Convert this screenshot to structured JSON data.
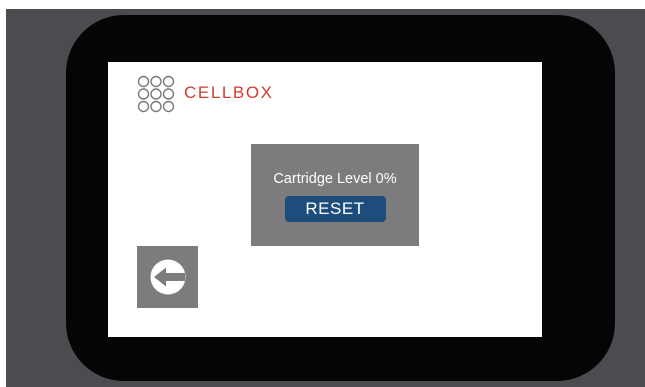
{
  "app": {
    "brand_name": "CELLBOX",
    "brand_color": "#d23b33"
  },
  "cartridge": {
    "label": "Cartridge Level 0%",
    "level_percent": 0,
    "reset_label": "RESET",
    "reset_color": "#1d4d7a",
    "panel_color": "#7c7c7c"
  },
  "navigation": {
    "back_icon": "back-arrow-icon"
  }
}
